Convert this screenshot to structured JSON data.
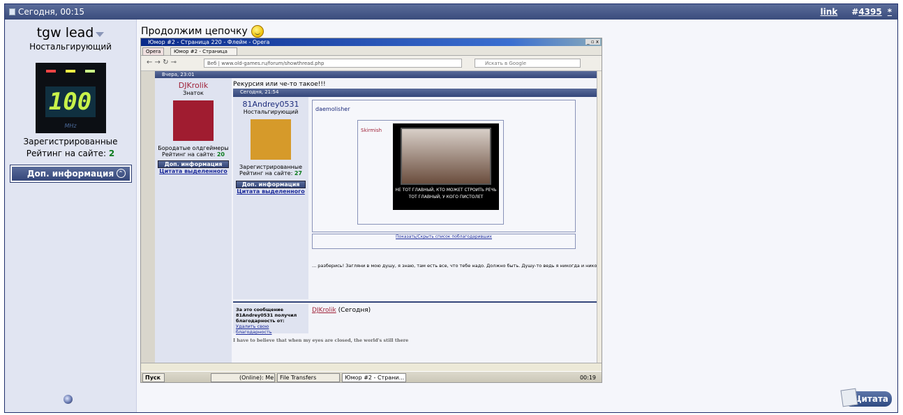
{
  "post": {
    "date": "Сегодня, 00:15",
    "link_label": "link",
    "post_number_prefix": "#",
    "post_number": "4395",
    "star": "*"
  },
  "author": {
    "name": "tgw lead",
    "title": "Ностальгирующий",
    "avatar": {
      "display": "100",
      "unit": "MHz"
    },
    "group": "Зарегистрированные",
    "rating_label": "Рейтинг на сайте:",
    "rating": "2",
    "more_info": "Доп. информация"
  },
  "message": {
    "text": "Продолжим цепочку"
  },
  "quote_button": "Цитата",
  "screenshot": {
    "window_title": "Юмор #2 - Страница 220 - Флейм - Opera",
    "tabs": [
      "Opera",
      "Юмор #2 - Страница 22..."
    ],
    "url_prefix": "Веб",
    "url": "www.old-games.ru/forum/showthread.php",
    "search_placeholder": "Искать в Google",
    "post1": {
      "date": "Вчера, 23:01",
      "author": "DJKrolik",
      "title": "Знаток",
      "group": "Бородатые олдгеймеры",
      "rating_label": "Рейтинг на сайте:",
      "rating": "20",
      "more_info": "Доп. информация",
      "quote_sel": "Цитата выделенного",
      "text": "Рекурсия или че-то такое!!!"
    },
    "post2": {
      "date": "Сегодня, 21:54",
      "author": "81Andrey0531",
      "title": "Ностальгирующий",
      "group": "Зарегистрированные",
      "rating_label": "Рейтинг на сайте:",
      "rating": "27",
      "more_info": "Доп. информация",
      "quote_sel": "Цитата выделенного",
      "nested_author": "daemolisher",
      "nested2_author": "Skirmish",
      "demotivator_line1": "НЕ ТОТ ГЛАВНЫЙ, КТО МОЖЕТ СТРОИТЬ РЕЧЬ",
      "demotivator_line2": "ТОТ ГЛАВНЫЙ, У КОГО ПИСТОЛЕТ",
      "thanks_toggle": "Показать/Скрыть список поблагодаривших",
      "signature": "... разберись! Загляни в мою душу, я знаю, там есть все, что тебе надо. Должно быть. Душу-то ведь я никогда и никому не пр"
    },
    "thanks": {
      "label": "За это сообщение 81Andrey0531 получил благодарность от:",
      "remove": "Удалить свою благодарность",
      "user": "DJKrolik",
      "when": "(Сегодня)"
    },
    "signature": "I have to believe that when my eyes are closed, the world's still there",
    "taskbar": {
      "start": "Пуск",
      "items": [
        "(Online): Me...",
        "File Transfers",
        "Юмор #2 - Страни..."
      ],
      "clock": "00:19"
    }
  }
}
